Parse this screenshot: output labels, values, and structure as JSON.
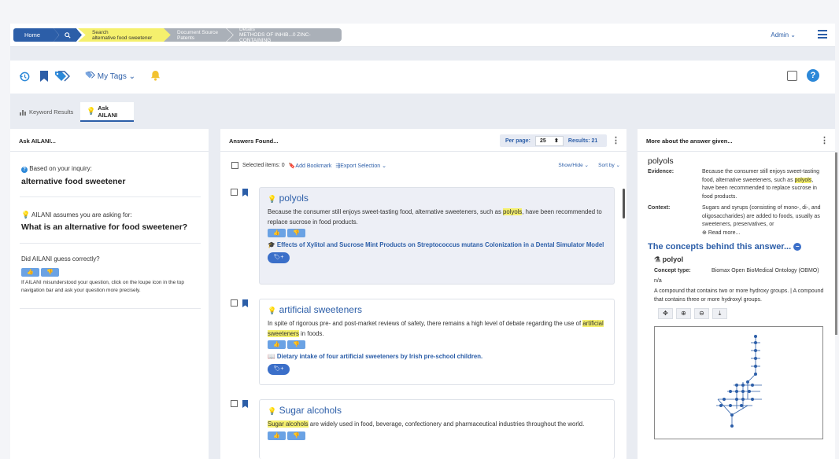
{
  "breadcrumb": {
    "home": "Home",
    "search_label": "Search",
    "search_value": "alternative food sweetener",
    "source_label": "Document Source",
    "source_value": "Patents",
    "details_label": "Details",
    "details_value": "METHODS OF INHIB...0 ZINC-CONTAINING"
  },
  "user": {
    "admin": "Admin ⌄"
  },
  "toolbar": {
    "mytags": "My Tags ⌄"
  },
  "tabs": [
    {
      "label": "Keyword Results"
    },
    {
      "label": "Ask AILANI"
    }
  ],
  "left": {
    "header": "Ask AILANI...",
    "based_label": "Based on your inquiry:",
    "inquiry": "alternative food sweetener",
    "assumes_label": "AILANI assumes you are asking for:",
    "question": "What is an alternative for food sweetener?",
    "guess_label": "Did AILANI guess correctly?",
    "hint": "If AILANI misunderstood your question, click on the loupe icon in the top navigation bar and ask your question more precisely."
  },
  "mid": {
    "header": "Answers Found...",
    "per_page_label": "Per page:",
    "per_page_value": "25",
    "results": "Results: 21",
    "selected": "Selected items: 0",
    "add_bookmark": "Add Bookmark",
    "export": "Export Selection ⌄",
    "show_hide": "Show/Hide ⌄",
    "sort_by": "Sort by ⌄",
    "answers": [
      {
        "title": "polyols",
        "text_before": "Because the consumer still enjoys sweet-tasting food, alternative sweeteners, such as ",
        "highlight": "polyols",
        "text_after": ", have been recommended to replace sucrose in food products.",
        "reference": "Effects of Xylitol and Sucrose Mint Products on Streptococcus mutans Colonization in a Dental Simulator Model"
      },
      {
        "title": "artificial sweeteners",
        "text_before": "In spite of rigorous pre- and post-market reviews of safety, there remains a high level of debate regarding the use of ",
        "highlight": "artificial sweeteners",
        "text_after": " in foods.",
        "reference": "Dietary intake of four artificial sweeteners by Irish pre-school children."
      },
      {
        "title": "Sugar alcohols",
        "text_before": "",
        "highlight": "Sugar alcohols",
        "text_after": " are widely used in food, beverage, confectionery and pharmaceutical industries throughout the world.",
        "reference": ""
      }
    ]
  },
  "right": {
    "header": "More about the answer given...",
    "term": "polyols",
    "evidence_label": "Evidence:",
    "evidence_before": "Because the consumer still enjoys sweet-tasting food, alternative sweeteners, such as ",
    "evidence_highlight": "polyols",
    "evidence_after": ", have been recommended to replace sucrose in food products.",
    "context_label": "Context:",
    "context": "Sugars and syrups (consisting of mono-, di-, and oligosaccharides) are added to foods, usually as sweeteners, preservatives, or",
    "read_more": "Read more...",
    "concepts_title": "The concepts behind this answer...",
    "concept_name": "polyol",
    "concept_type_label": "Concept type:",
    "concept_type": "Biomax Open BioMedical Ontology (OBMO)",
    "na": "n/a",
    "definition": "A compound that contains two or more hydroxy groups. | A compound that contains three or more hydroxyl groups."
  }
}
